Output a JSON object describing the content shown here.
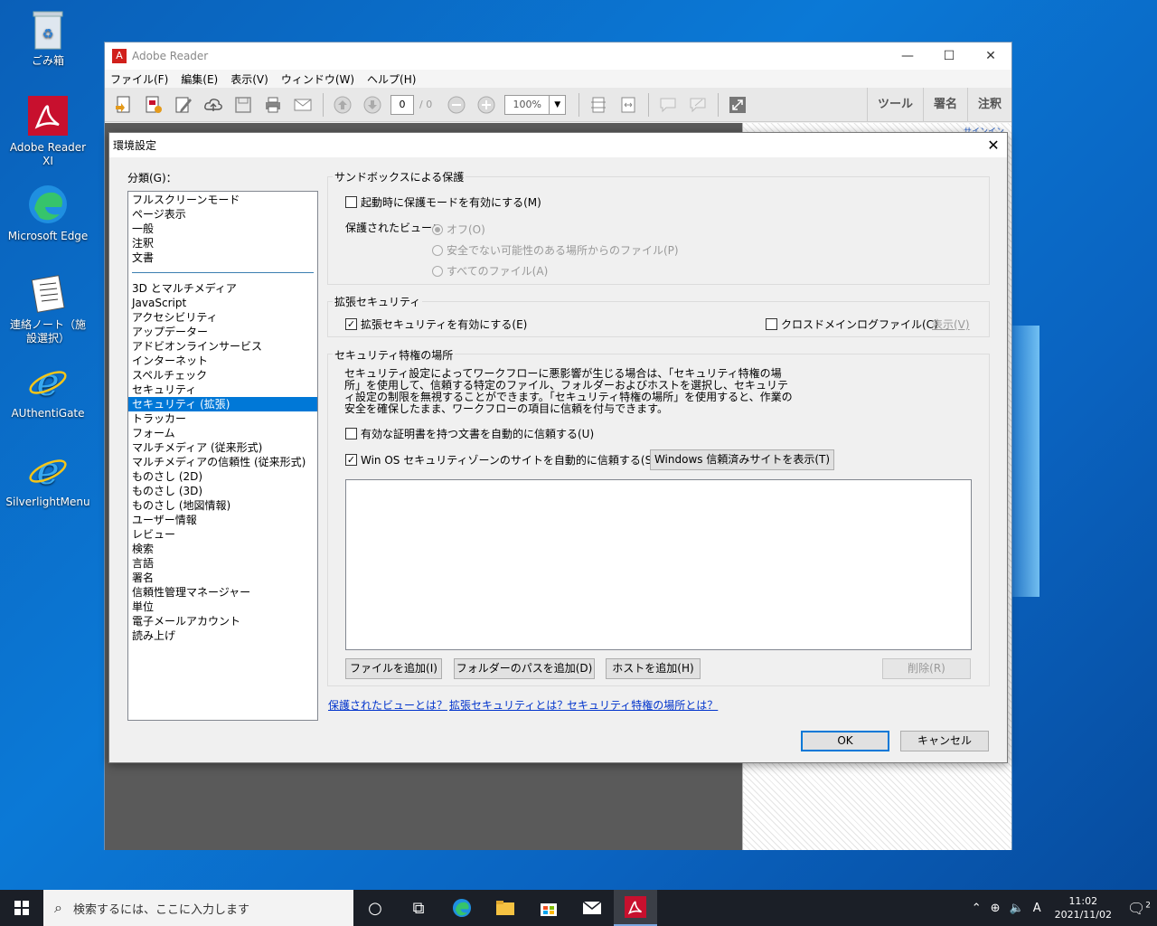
{
  "desktop": {
    "icons": [
      {
        "label": "ごみ箱"
      },
      {
        "label": "Adobe Reader XI"
      },
      {
        "label": "Microsoft Edge"
      },
      {
        "label": "連絡ノート（施設選択）"
      },
      {
        "label": "AUthentiGate"
      },
      {
        "label": "SilverlightMenu"
      }
    ]
  },
  "reader": {
    "title": "Adobe Reader",
    "menu": [
      "ファイル(F)",
      "編集(E)",
      "表示(V)",
      "ウィンドウ(W)",
      "ヘルプ(H)"
    ],
    "page_current": "0",
    "page_total": "/ 0",
    "zoom": "100%",
    "right_buttons": [
      "ツール",
      "署名",
      "注釈"
    ],
    "side_link": "サインイン"
  },
  "dialog": {
    "title": "環境設定",
    "category_label": "分類(G)：",
    "categories_top": [
      "フルスクリーンモード",
      "ページ表示",
      "一般",
      "注釈",
      "文書"
    ],
    "categories": [
      "3D とマルチメディア",
      "JavaScript",
      "アクセシビリティ",
      "アップデーター",
      "アドビオンラインサービス",
      "インターネット",
      "スペルチェック",
      "セキュリティ",
      "セキュリティ (拡張)",
      "トラッカー",
      "フォーム",
      "マルチメディア (従来形式)",
      "マルチメディアの信頼性 (従来形式)",
      "ものさし (2D)",
      "ものさし (3D)",
      "ものさし (地図情報)",
      "ユーザー情報",
      "レビュー",
      "検索",
      "言語",
      "署名",
      "信頼性管理マネージャー",
      "単位",
      "電子メールアカウント",
      "読み上げ"
    ],
    "selected_category": "セキュリティ (拡張)",
    "sandbox": {
      "title": "サンドボックスによる保護",
      "protected_mode_label": "起動時に保護モードを有効にする(M)",
      "protected_mode_checked": false,
      "protected_view_label": "保護されたビュー：",
      "options": [
        "オフ(O)",
        "安全でない可能性のある場所からのファイル(P)",
        "すべてのファイル(A)"
      ],
      "selected_option": "オフ(O)"
    },
    "enhanced": {
      "title": "拡張セキュリティ",
      "enable_label": "拡張セキュリティを有効にする(E)",
      "enable_checked": true,
      "crossdomain_label": "クロスドメインログファイル(C)",
      "crossdomain_checked": false,
      "view_link": "表示(V)"
    },
    "privileged": {
      "title": "セキュリティ特権の場所",
      "description": "セキュリティ設定によってワークフローに悪影響が生じる場合は、「セキュリティ特権の場所」を使用して、信頼する特定のファイル、フォルダーおよびホストを選択し、セキュリティ設定の制限を無視することができます。「セキュリティ特権の場所」を使用すると、作業の安全を確保したまま、ワークフローの項目に信頼を付与できます。",
      "trust_cert_label": "有効な証明書を持つ文書を自動的に信頼する(U)",
      "trust_cert_checked": false,
      "trust_zone_label": "Win OS セキュリティゾーンのサイトを自動的に信頼する(S)",
      "trust_zone_checked": true,
      "show_sites_button": "Windows 信頼済みサイトを表示(T)",
      "add_file_button": "ファイルを追加(I)",
      "add_folder_button": "フォルダーのパスを追加(D)",
      "add_host_button": "ホストを追加(H)",
      "remove_button": "削除(R)"
    },
    "links": [
      "保護されたビューとは？",
      "拡張セキュリティとは？",
      "セキュリティ特権の場所とは？"
    ],
    "ok_button": "OK",
    "cancel_button": "キャンセル"
  },
  "taskbar": {
    "search_placeholder": "検索するには、ここに入力します",
    "ime": "A",
    "time": "11:02",
    "date": "2021/11/02",
    "notification_count": "2"
  }
}
